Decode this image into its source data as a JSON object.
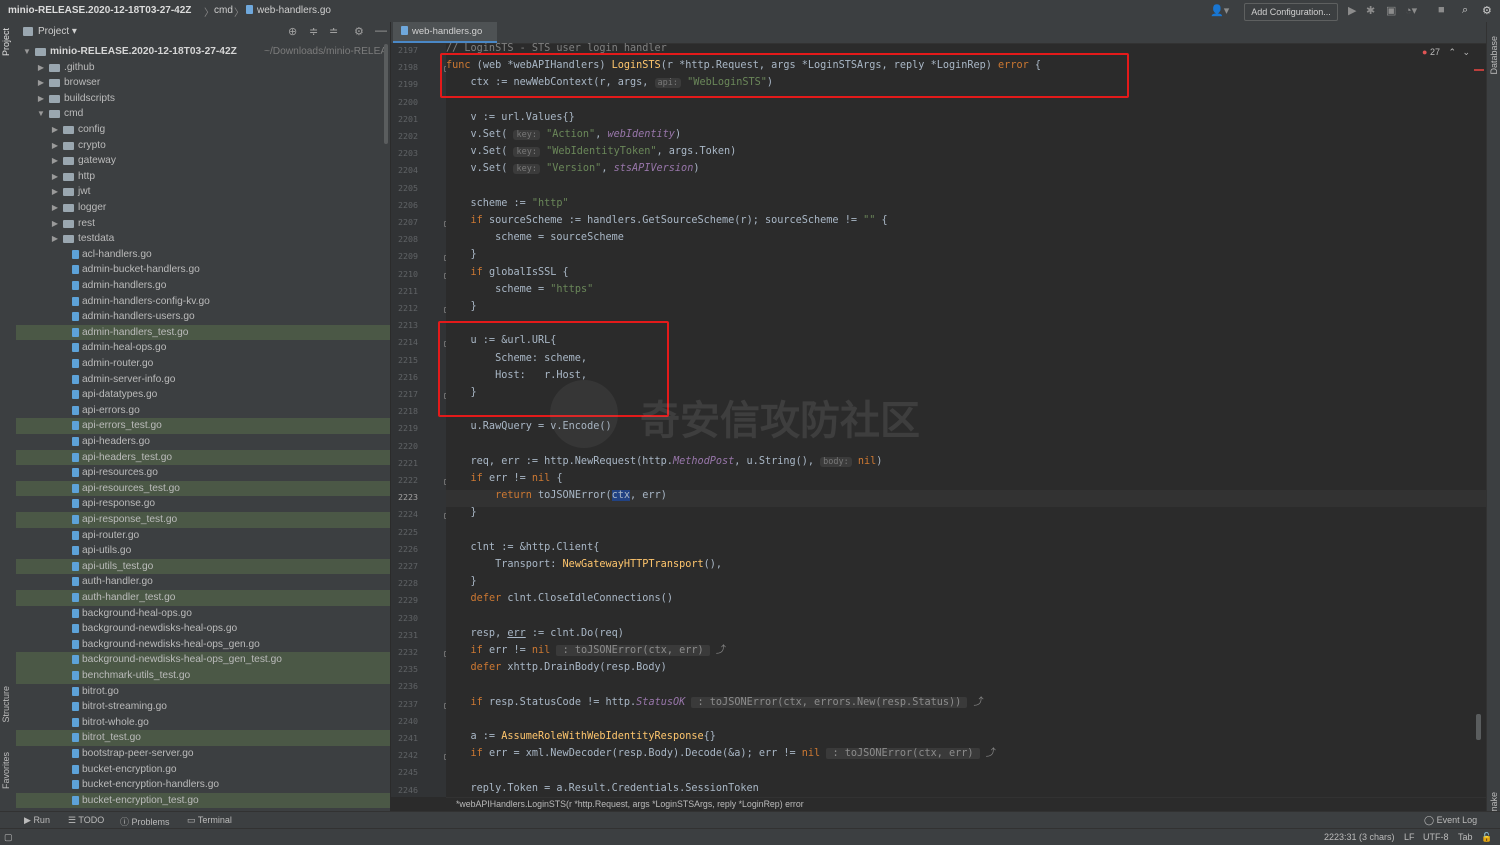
{
  "titlebar": {
    "project": "minio-RELEASE.2020-12-18T03-27-42Z",
    "dir": "cmd",
    "file": "web-handlers.go",
    "add_config": "Add Configuration..."
  },
  "side_labels": {
    "project": "Project",
    "structure": "Structure",
    "favorites": "Favorites",
    "database": "Database",
    "make": "make"
  },
  "project_panel": {
    "title": "Project",
    "root": "minio-RELEASE.2020-12-18T03-27-42Z",
    "root_path": "~/Downloads/minio-RELEA",
    "folders": [
      ".github",
      "browser",
      "buildscripts",
      "cmd"
    ],
    "cmd_folders": [
      "config",
      "crypto",
      "gateway",
      "http",
      "jwt",
      "logger",
      "rest",
      "testdata"
    ],
    "files": [
      {
        "name": "acl-handlers.go",
        "test": false
      },
      {
        "name": "admin-bucket-handlers.go",
        "test": false
      },
      {
        "name": "admin-handlers.go",
        "test": false
      },
      {
        "name": "admin-handlers-config-kv.go",
        "test": false
      },
      {
        "name": "admin-handlers-users.go",
        "test": false
      },
      {
        "name": "admin-handlers_test.go",
        "test": true
      },
      {
        "name": "admin-heal-ops.go",
        "test": false
      },
      {
        "name": "admin-router.go",
        "test": false
      },
      {
        "name": "admin-server-info.go",
        "test": false
      },
      {
        "name": "api-datatypes.go",
        "test": false
      },
      {
        "name": "api-errors.go",
        "test": false
      },
      {
        "name": "api-errors_test.go",
        "test": true
      },
      {
        "name": "api-headers.go",
        "test": false
      },
      {
        "name": "api-headers_test.go",
        "test": true
      },
      {
        "name": "api-resources.go",
        "test": false
      },
      {
        "name": "api-resources_test.go",
        "test": true
      },
      {
        "name": "api-response.go",
        "test": false
      },
      {
        "name": "api-response_test.go",
        "test": true
      },
      {
        "name": "api-router.go",
        "test": false
      },
      {
        "name": "api-utils.go",
        "test": false
      },
      {
        "name": "api-utils_test.go",
        "test": true
      },
      {
        "name": "auth-handler.go",
        "test": false
      },
      {
        "name": "auth-handler_test.go",
        "test": true
      },
      {
        "name": "background-heal-ops.go",
        "test": false
      },
      {
        "name": "background-newdisks-heal-ops.go",
        "test": false
      },
      {
        "name": "background-newdisks-heal-ops_gen.go",
        "test": false
      },
      {
        "name": "background-newdisks-heal-ops_gen_test.go",
        "test": true
      },
      {
        "name": "benchmark-utils_test.go",
        "test": true
      },
      {
        "name": "bitrot.go",
        "test": false
      },
      {
        "name": "bitrot-streaming.go",
        "test": false
      },
      {
        "name": "bitrot-whole.go",
        "test": false
      },
      {
        "name": "bitrot_test.go",
        "test": true
      },
      {
        "name": "bootstrap-peer-server.go",
        "test": false
      },
      {
        "name": "bucket-encryption.go",
        "test": false
      },
      {
        "name": "bucket-encryption-handlers.go",
        "test": false
      },
      {
        "name": "bucket-encryption_test.go",
        "test": true
      }
    ]
  },
  "editor": {
    "tab": "web-handlers.go",
    "current_line": "2223",
    "line_numbers": [
      "2197",
      "2198",
      "2199",
      "2200",
      "2201",
      "2202",
      "2203",
      "2204",
      "2205",
      "2206",
      "2207",
      "2208",
      "2209",
      "2210",
      "2211",
      "2212",
      "2213",
      "2214",
      "2215",
      "2216",
      "2217",
      "2218",
      "2219",
      "2220",
      "2221",
      "2222",
      "2223",
      "2224",
      "2225",
      "2226",
      "2227",
      "2228",
      "2229",
      "2230",
      "2231",
      "2232",
      "2235",
      "2236",
      "2237",
      "2240",
      "2241",
      "2242",
      "2245",
      "2246"
    ],
    "problems_count": "27",
    "breadcrumb": "*webAPIHandlers.LoginSTS(r *http.Request, args *LoginSTSArgs, reply *LoginRep) error",
    "code": {
      "l2197": "// LoginSTS - STS user login handler",
      "func_kw": "func",
      "recv": " (web *webAPIHandlers) ",
      "fname": "LoginSTS",
      "params": "(r *http.Request, args *LoginSTSArgs, reply *LoginRep) ",
      "err_kw": "error",
      "brace": " {",
      "l2199_a": "    ctx := newWebContext(r, args, ",
      "hint_api": "api:",
      "l2199_s": "\"WebLoginSTS\"",
      "l2199_b": ")",
      "l2201": "    v := url.Values{}",
      "set_pre": "    v.Set(",
      "hint_key": "key:",
      "s_action": "\"Action\"",
      "v_webid": "webIdentity",
      "s_wit": "\"WebIdentityToken\"",
      "v_token": ", args.Token)",
      "s_version": "\"Version\"",
      "v_stsver": "stsAPIVersion",
      "close_paren": ")",
      "comma": ", ",
      "l2206_a": "    scheme := ",
      "s_http": "\"http\"",
      "if_kw": "if",
      "l2207_a": " sourceScheme := handlers.GetSourceScheme(r); sourceScheme != ",
      "s_empty": "\"\"",
      "l2208": "        scheme = sourceScheme",
      "rbrace": "    }",
      "l2210_a": " globalIsSSL {",
      "l2211_a": "        scheme = ",
      "s_https": "\"https\"",
      "l2214": "    u := &url.URL{",
      "l2215": "        Scheme: scheme,",
      "l2216": "        Host:   r.Host,",
      "l2219": "    u.RawQuery = v.Encode()",
      "l2221_a": "    req, err := http.NewRequest(http.",
      "v_post": "MethodPost",
      "l2221_b": ", u.String(), ",
      "hint_body": "body:",
      "nil_kw": "nil",
      "l2222_a": " err != ",
      "return_kw": "return",
      "l2223_a": " toJSONError(",
      "sel_ctx": "ctx",
      "l2223_b": ", err)",
      "l2226": "    clnt := &http.Client{",
      "l2227_a": "        Transport: ",
      "l2227_fn": "NewGatewayHTTPTransport",
      "l2227_b": "(),",
      "defer_kw": "defer",
      "l2229_b": " clnt.CloseIdleConnections()",
      "l2231_a": "    resp, ",
      "ul_err": "err",
      "l2231_b": " := clnt.Do(req)",
      "inl_2232": " : toJSONError(ctx, err) ",
      "l2235_b": " xhttp.DrainBody(resp.Body)",
      "l2237_a": " resp.StatusCode != http.",
      "v_statusok": "StatusOK",
      "inl_2237": " : toJSONError(ctx, errors.New(resp.Status)) ",
      "l2241_a": "    a := ",
      "l2241_fn": "AssumeRoleWithWebIdentityResponse",
      "l2241_b": "{}",
      "l2242_a": " err = xml.NewDecoder(resp.Body).Decode(&a); err != ",
      "inl_2242": " : toJSONError(ctx, err) ",
      "l2246": "    reply.Token = a.Result.Credentials.SessionToken"
    }
  },
  "watermark": "奇安信攻防社区",
  "toolstrip": {
    "run": "Run",
    "todo": "TODO",
    "problems": "Problems",
    "terminal": "Terminal",
    "event_log": "Event Log"
  },
  "statusbar": {
    "position": "2223:31 (3 chars)",
    "line_sep": "LF",
    "encoding": "UTF-8",
    "indent": "Tab"
  },
  "colors": {
    "keyword": "#cc7832",
    "function": "#ffc66d",
    "string": "#6a8759",
    "highlight_box": "#e41a1a",
    "test_row": "#4b5846"
  }
}
